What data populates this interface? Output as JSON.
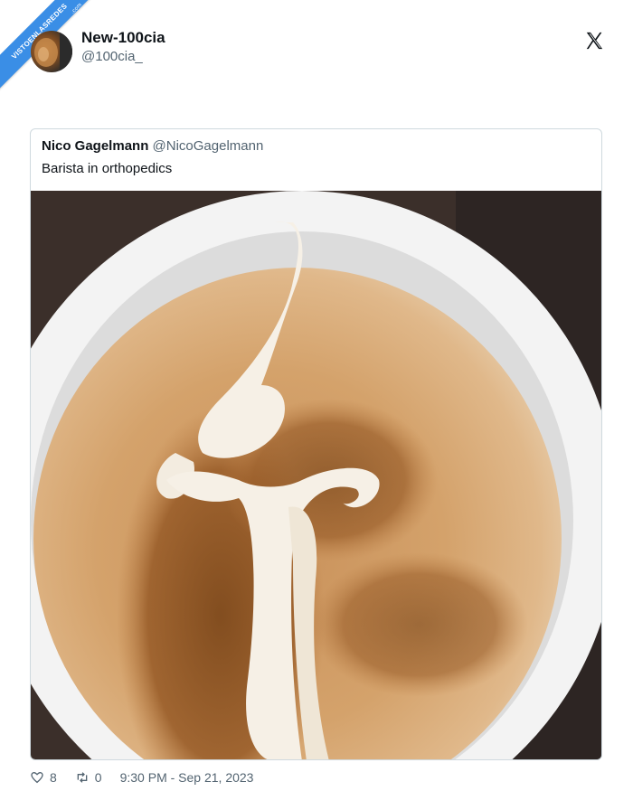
{
  "watermark": {
    "text": "VISTOENLASREDES",
    "sub": ".com"
  },
  "tweet": {
    "author_name": "New-100cia",
    "author_handle": "@100cia_"
  },
  "quoted": {
    "author_name": "Nico Gagelmann",
    "author_handle": "@NicoGagelmann",
    "text": "Barista in orthopedics"
  },
  "footer": {
    "likes": "8",
    "retweets": "0",
    "timestamp": "9:30 PM - Sep 21, 2023"
  },
  "icons": [
    "x-logo-icon",
    "heart-icon",
    "retweet-icon"
  ]
}
